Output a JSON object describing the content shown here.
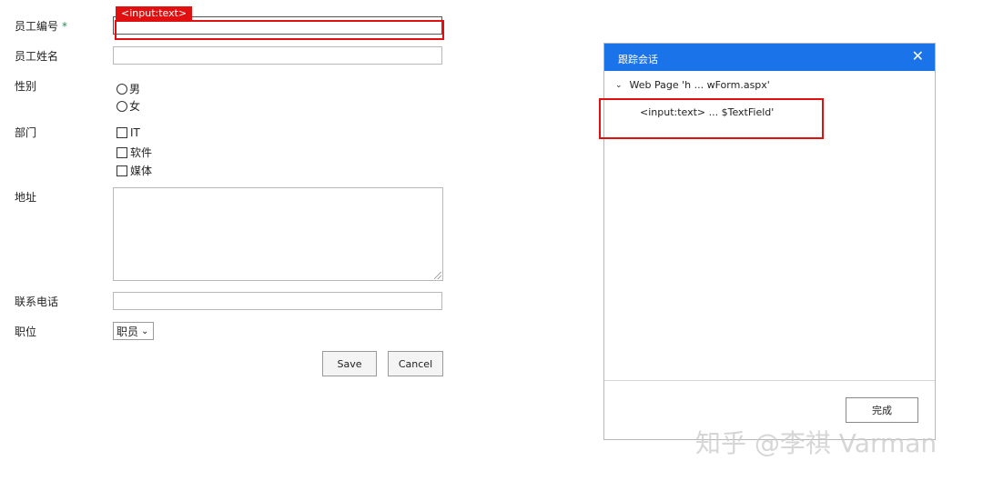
{
  "form": {
    "employee_id_label": "员工编号",
    "required_mark": "*",
    "employee_name_label": "员工姓名",
    "gender_label": "性别",
    "gender_options": [
      "男",
      "女"
    ],
    "department_label": "部门",
    "department_options": [
      "IT",
      "软件",
      "媒体"
    ],
    "address_label": "地址",
    "phone_label": "联系电话",
    "position_label": "职位",
    "position_value": "职员",
    "save_label": "Save",
    "cancel_label": "Cancel"
  },
  "highlight": {
    "tag": "<input:text>",
    "color": "#e01010"
  },
  "dialog": {
    "title": "跟踪会话",
    "close_icon": "close-icon",
    "tree_root": "Web Page 'h ... wForm.aspx'",
    "tree_child": "<input:text>  ... $TextField'",
    "done_label": "完成",
    "header_color": "#1a73e8"
  },
  "watermark": "知乎 @李祺 Varman"
}
